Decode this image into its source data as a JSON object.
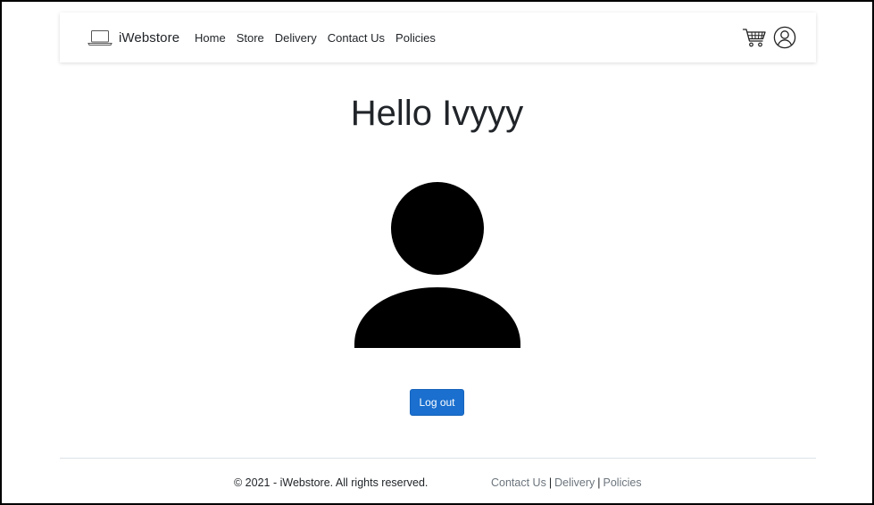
{
  "navbar": {
    "brand_icon": "laptop-icon",
    "brand_name": "iWebstore",
    "links": [
      {
        "label": "Home"
      },
      {
        "label": "Store"
      },
      {
        "label": "Delivery"
      },
      {
        "label": "Contact Us"
      },
      {
        "label": "Policies"
      }
    ],
    "cart_icon": "cart-icon",
    "account_icon": "user-circle-icon"
  },
  "main": {
    "greeting_prefix": "Hello",
    "user_name": "Ivyyy",
    "avatar_icon": "person-icon",
    "logout_label": "Log out",
    "accent_color": "#1a6fcf"
  },
  "footer": {
    "copyright": "© 2021 - iWebstore. All rights reserved.",
    "links": [
      {
        "label": "Contact Us"
      },
      {
        "label": "Delivery"
      },
      {
        "label": "Policies"
      }
    ],
    "separator": "|"
  }
}
